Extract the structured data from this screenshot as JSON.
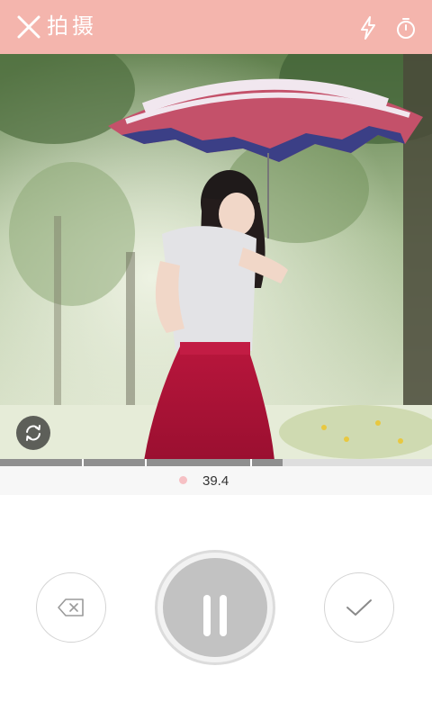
{
  "header": {
    "title": "拍摄",
    "close_icon": "close-icon",
    "flash_icon": "flash-icon",
    "timer_icon": "timer-icon",
    "bg_color": "#f4b5ad"
  },
  "preview": {
    "switch_camera_icon": "camera-switch-icon"
  },
  "recording": {
    "progress_fraction": 0.655,
    "segment_marks": [
      0.19,
      0.335,
      0.58
    ],
    "time": "39.4",
    "dot_color": "#f6c0c4"
  },
  "controls": {
    "delete_icon": "backspace-icon",
    "record_state": "paused",
    "confirm_icon": "check-icon"
  }
}
